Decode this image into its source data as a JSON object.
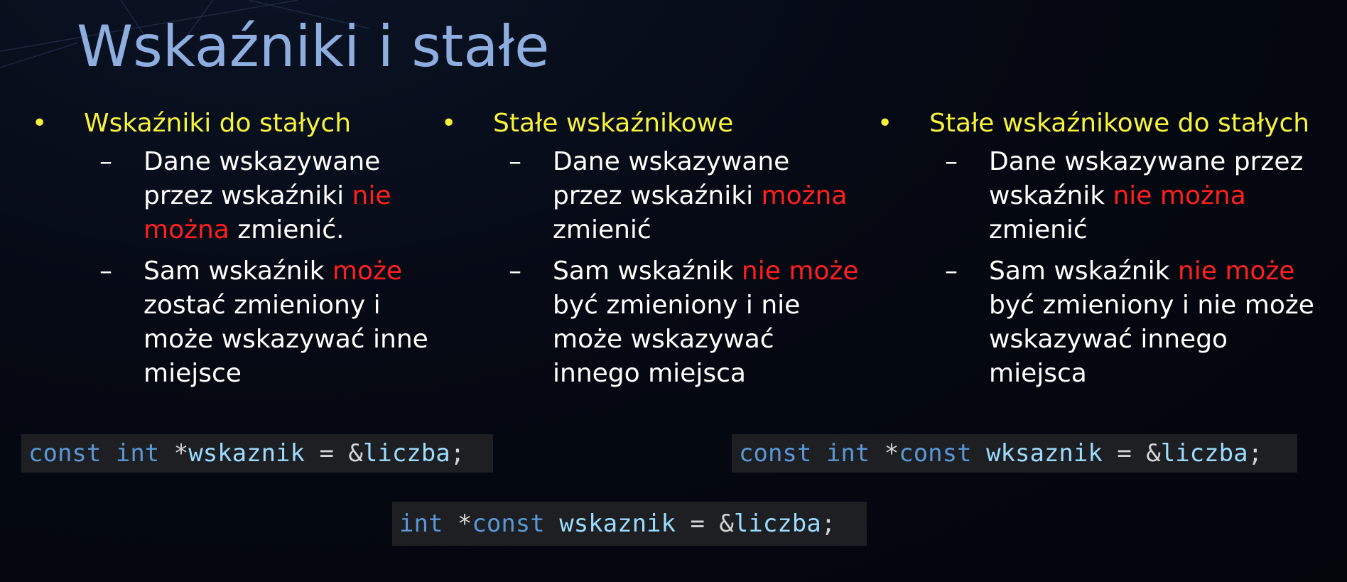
{
  "slide": {
    "title": "Wskaźniki i stałe",
    "colors": {
      "title": "#8faee0",
      "heading": "#f7f23a",
      "text": "#ffffff",
      "highlight": "#ff1f1f",
      "code_keyword": "#5a97d6",
      "code_identifier": "#9cdcfe",
      "code_background": "#1d1f22"
    },
    "columns": [
      {
        "bullet": "•",
        "heading": "Wskaźniki do stałych",
        "items": [
          {
            "dash": "–",
            "lines": [
              {
                "a": "Dane wskazywane",
                "r": ""
              },
              {
                "a": "przez wskaźniki ",
                "r": "nie"
              },
              {
                "r": "można",
                "b": " zmienić."
              }
            ]
          },
          {
            "dash": "–",
            "lines": [
              {
                "a": "Sam wskaźnik ",
                "r": "może"
              },
              {
                "a": "zostać zmieniony i"
              },
              {
                "a": "może wskazywać inne"
              },
              {
                "a": "miejsce"
              }
            ]
          }
        ]
      },
      {
        "bullet": "•",
        "heading": "Stałe wskaźnikowe",
        "items": [
          {
            "dash": "–",
            "lines": [
              {
                "a": "Dane wskazywane"
              },
              {
                "a": "przez wskaźniki ",
                "r": "można"
              },
              {
                "a": "zmienić"
              }
            ]
          },
          {
            "dash": "–",
            "lines": [
              {
                "a": "Sam wskaźnik ",
                "r": "nie może"
              },
              {
                "a": "być zmieniony i nie"
              },
              {
                "a": "może wskazywać"
              },
              {
                "a": "innego miejsca"
              }
            ]
          }
        ]
      },
      {
        "bullet": "•",
        "heading": "Stałe wskaźnikowe do stałych",
        "items": [
          {
            "dash": "–",
            "lines": [
              {
                "a": "Dane wskazywane przez"
              },
              {
                "a": "wskaźnik ",
                "r": "nie można"
              },
              {
                "a": "zmienić"
              }
            ]
          },
          {
            "dash": "–",
            "lines": [
              {
                "a": "Sam wskaźnik ",
                "r": "nie może"
              },
              {
                "a": "być zmieniony i nie może"
              },
              {
                "a": "wskazywać innego"
              },
              {
                "a": "miejsca"
              }
            ]
          }
        ]
      }
    ],
    "code": {
      "line1": {
        "kw1": "const",
        "sp1": " ",
        "kw2": "int",
        "sp2": " ",
        "op1": "*",
        "id1": "wskaznik",
        "op2": " = &",
        "id2": "liczba",
        "op3": ";"
      },
      "line2": {
        "kw1": "int",
        "sp1": " ",
        "op1": "*",
        "kw2": "const",
        "sp2": " ",
        "id1": "wskaznik",
        "op2": " = &",
        "id2": "liczba",
        "op3": ";"
      },
      "line3": {
        "kw1": "const",
        "sp1": " ",
        "kw2": "int",
        "sp2": " ",
        "op1": "*",
        "kw3": "const",
        "sp3": " ",
        "id1": "wksaznik",
        "op2": " = &",
        "id2": "liczba",
        "op3": ";"
      }
    }
  }
}
